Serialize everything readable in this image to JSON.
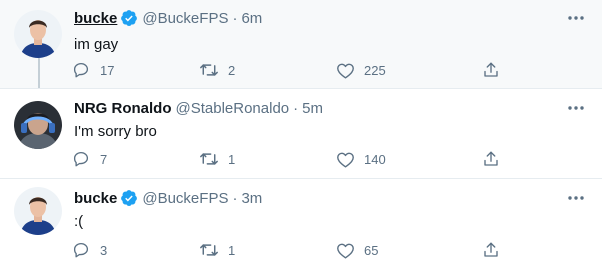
{
  "tweets": [
    {
      "name": "bucke",
      "handle": "@BuckeFPS",
      "separator": "·",
      "time": "6m",
      "text": "im gay",
      "verified": true,
      "replies": "17",
      "retweets": "2",
      "likes": "225"
    },
    {
      "name": "NRG Ronaldo",
      "handle": "@StableRonaldo",
      "separator": "·",
      "time": "5m",
      "text": "I'm sorry bro",
      "verified": false,
      "replies": "7",
      "retweets": "1",
      "likes": "140"
    },
    {
      "name": "bucke",
      "handle": "@BuckeFPS",
      "separator": "·",
      "time": "3m",
      "text": ":(",
      "verified": true,
      "replies": "3",
      "retweets": "1",
      "likes": "65"
    }
  ],
  "icons": {
    "reply": "reply-icon",
    "retweet": "retweet-icon",
    "like": "heart-icon",
    "share": "share-icon",
    "more": "more-options-icon",
    "verified": "verified-badge-icon"
  },
  "colors": {
    "accent": "#1da1f2",
    "secondary_text": "#5b7083",
    "highlight_bg": "#f7f9fa",
    "divider": "#e6ecf0"
  }
}
